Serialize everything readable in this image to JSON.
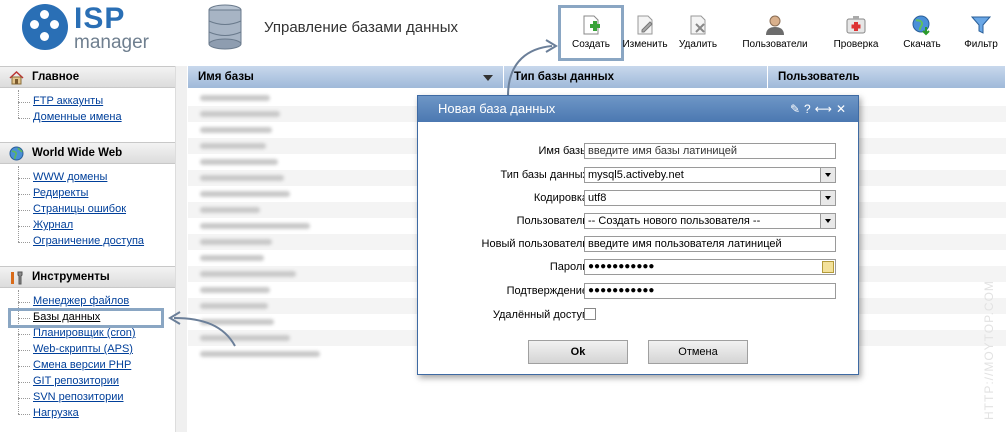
{
  "app": {
    "logo_isp": "ISP",
    "logo_manager": "manager",
    "page_title": "Управление базами данных"
  },
  "toolbar": {
    "create": "Создать",
    "edit": "Изменить",
    "delete": "Удалить",
    "users": "Пользователи",
    "check": "Проверка",
    "download": "Скачать",
    "filter": "Фильтр"
  },
  "sidebar": {
    "sections": [
      {
        "title": "Главное",
        "items": [
          "FTP аккаунты",
          "Доменные имена"
        ]
      },
      {
        "title": "World Wide Web",
        "items": [
          "WWW домены",
          "Редиректы",
          "Страницы ошибок",
          "Журнал",
          "Ограничение доступа"
        ]
      },
      {
        "title": "Инструменты",
        "items": [
          "Менеджер файлов",
          "Базы данных",
          "Планировщик (cron)",
          "Web-скрипты (APS)",
          "Смена версии PHP",
          "GIT репозитории",
          "SVN репозитории",
          "Нагрузка"
        ]
      }
    ],
    "selected_item": "Базы данных"
  },
  "table": {
    "columns": [
      "Имя базы",
      "Тип базы данных",
      "Пользователь"
    ]
  },
  "dialog": {
    "title": "Новая база данных",
    "fields": {
      "db_name_label": "Имя базы",
      "db_name_value": "введите имя базы латиницей",
      "db_type_label": "Тип базы данных",
      "db_type_value": "mysql5.activeby.net",
      "encoding_label": "Кодировка",
      "encoding_value": "utf8",
      "user_label": "Пользователь",
      "user_value": "-- Создать нового пользователя --",
      "new_user_label": "Новый пользователь",
      "new_user_value": "введите имя пользователя латиницей",
      "password_label": "Пароль",
      "password_value": "●●●●●●●●●●●",
      "confirm_label": "Подтверждение",
      "confirm_value": "●●●●●●●●●●●",
      "remote_label": "Удалённый доступ"
    },
    "ok_label": "Ok",
    "cancel_label": "Отмена"
  },
  "watermark": "HTTP://MOYTOP.COM",
  "colors": {
    "brand": "#2a6fb5",
    "header_blue": "#9fb9d9",
    "dialog_title": "#4b78b1",
    "link": "#003f9a",
    "highlight": "#8aa6c3"
  }
}
